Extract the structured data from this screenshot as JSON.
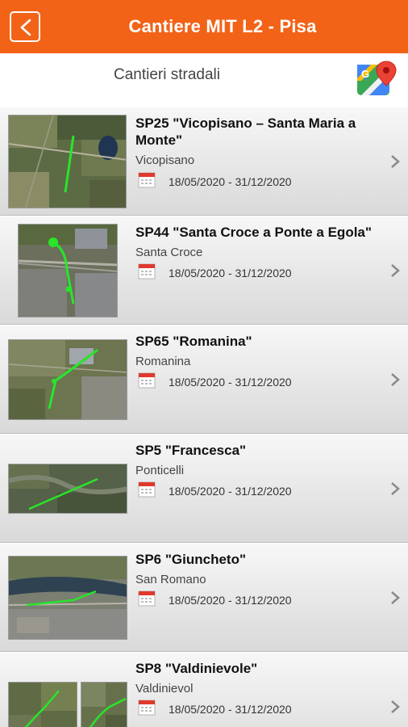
{
  "header": {
    "title": "Cantiere MIT L2 - Pisa",
    "back_icon": "chevron-left-icon"
  },
  "subheader": {
    "title": "Cantieri stradali",
    "maps_icon": "google-maps-icon"
  },
  "colors": {
    "accent": "#f26317",
    "route": "#28e52a"
  },
  "items": [
    {
      "title": "SP25 \"Vicopisano – Santa Maria a Monte\"",
      "place": "Vicopisano",
      "dates": "18/05/2020 - 31/12/2020"
    },
    {
      "title": "SP44 \"Santa Croce a Ponte a Egola\"",
      "place": "Santa Croce",
      "dates": "18/05/2020 - 31/12/2020"
    },
    {
      "title": "SP65 \"Romanina\"",
      "place": "Romanina",
      "dates": "18/05/2020 - 31/12/2020"
    },
    {
      "title": "SP5 \"Francesca\"",
      "place": "Ponticelli",
      "dates": "18/05/2020 - 31/12/2020"
    },
    {
      "title": "SP6 \"Giuncheto\"",
      "place": "San Romano",
      "dates": "18/05/2020 - 31/12/2020"
    },
    {
      "title": "SP8 \"Valdinievole\"",
      "place": "Valdinievol",
      "dates": "18/05/2020 - 31/12/2020"
    }
  ]
}
